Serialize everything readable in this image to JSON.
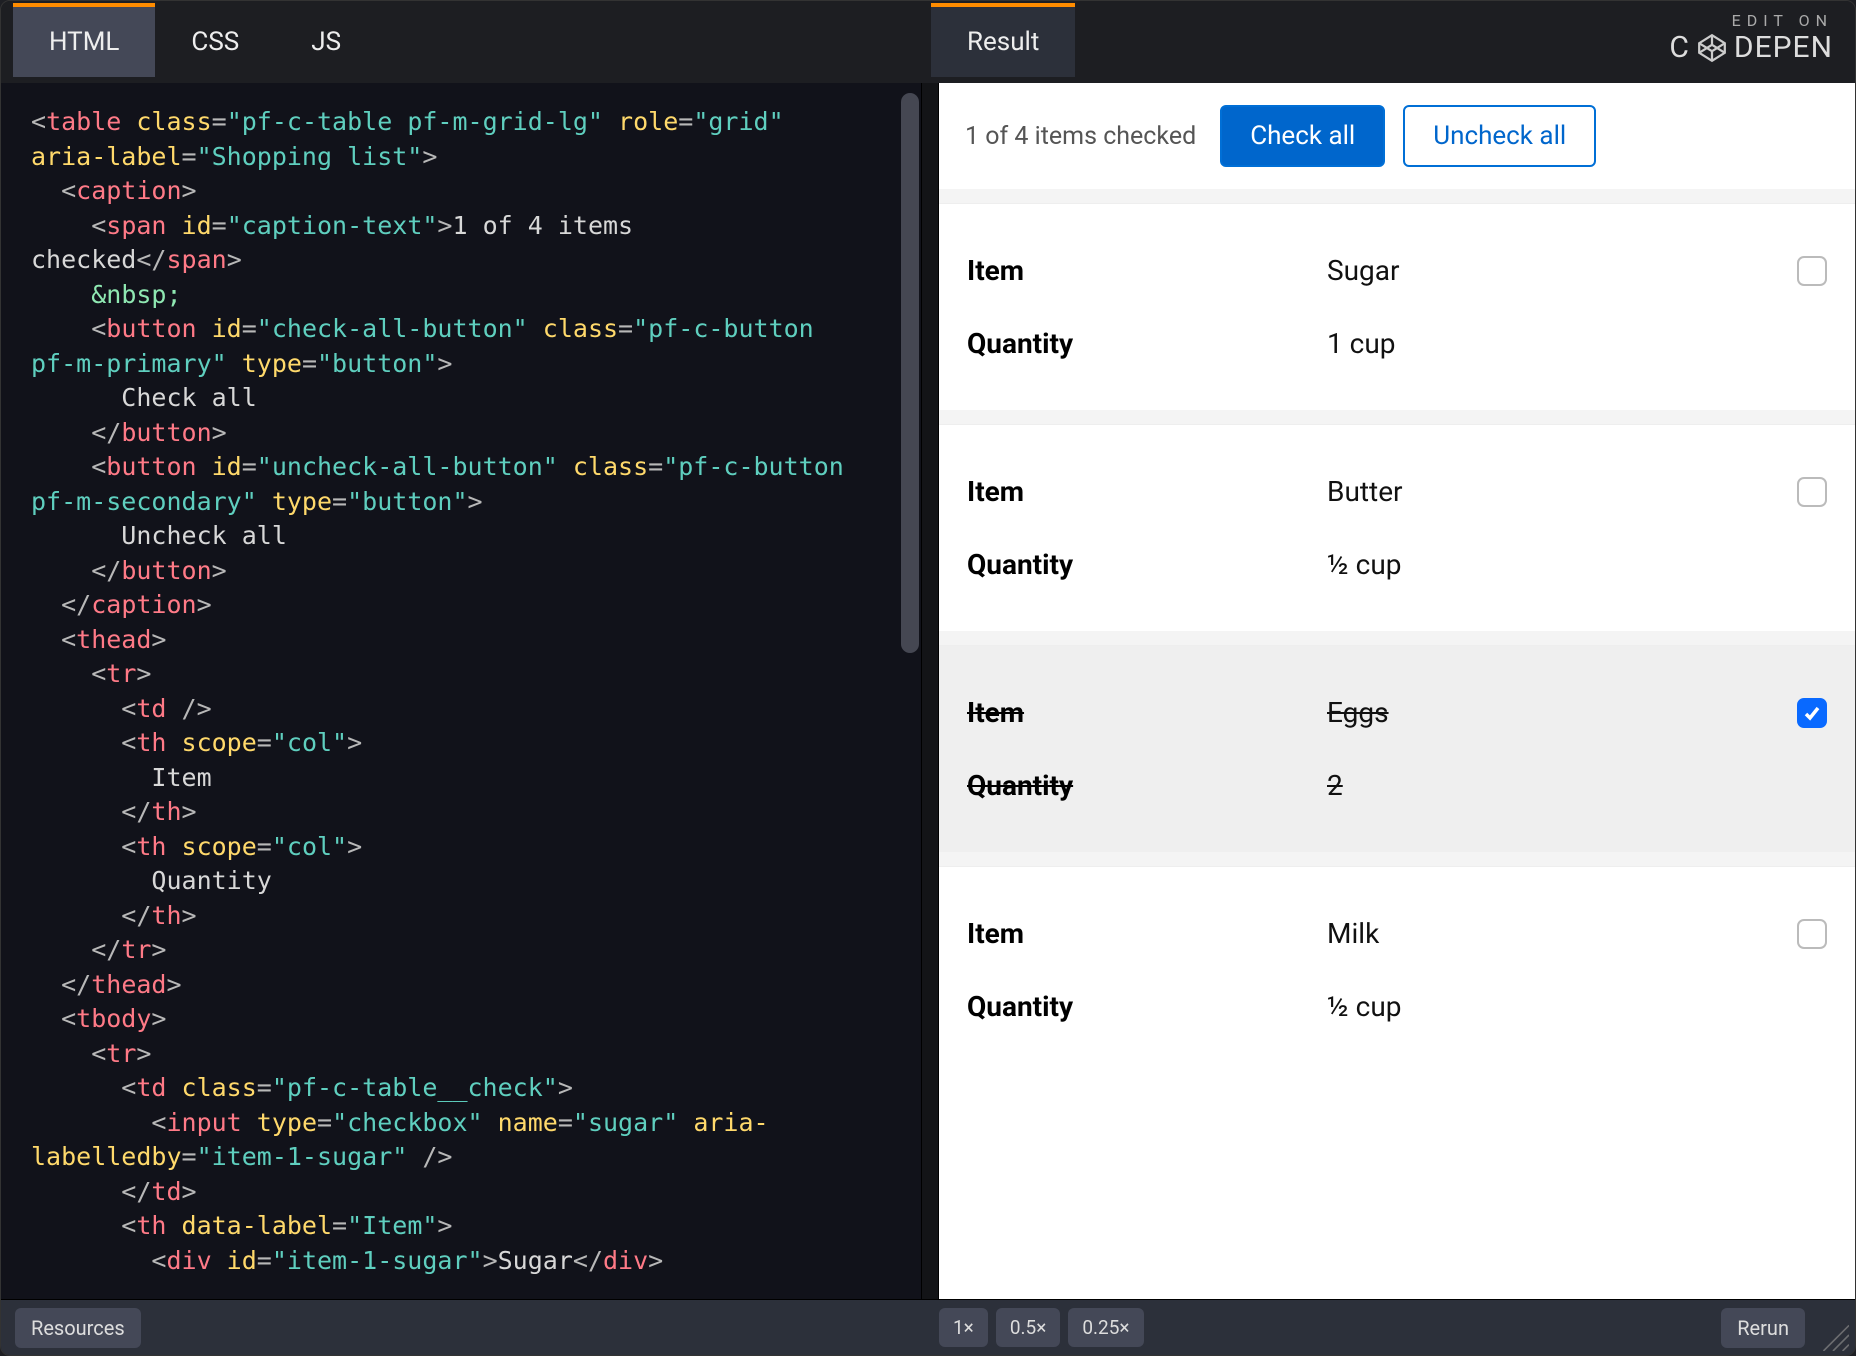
{
  "brand": {
    "edit_on": "EDIT ON",
    "name": "C   DEPEN"
  },
  "tabs": {
    "html": "HTML",
    "css": "CSS",
    "js": "JS",
    "result": "Result"
  },
  "code": {
    "l01a": "<",
    "l01b": "table",
    "l01c": " class",
    "l01d": "=",
    "l01e": "\"pf-c-table pf-m-grid-lg\"",
    "l01f": " role",
    "l01g": "=",
    "l01h": "\"grid\"",
    "l02a": "aria-label",
    "l02b": "=",
    "l02c": "\"Shopping list\"",
    "l02d": ">",
    "l03a": "  <",
    "l03b": "caption",
    "l03c": ">",
    "l04a": "    <",
    "l04b": "span",
    "l04c": " id",
    "l04d": "=",
    "l04e": "\"caption-text\"",
    "l04f": ">",
    "l04g": "1 of 4 items",
    "l05a": "checked",
    "l05b": "</",
    "l05c": "span",
    "l05d": ">",
    "l06a": "    ",
    "l06b": "&nbsp;",
    "l07a": "    <",
    "l07b": "button",
    "l07c": " id",
    "l07d": "=",
    "l07e": "\"check-all-button\"",
    "l07f": " class",
    "l07g": "=",
    "l07h": "\"pf-c-button",
    "l08a": "pf-m-primary\"",
    "l08b": " type",
    "l08c": "=",
    "l08d": "\"button\"",
    "l08e": ">",
    "l09a": "      Check all",
    "l10a": "    </",
    "l10b": "button",
    "l10c": ">",
    "l11a": "    <",
    "l11b": "button",
    "l11c": " id",
    "l11d": "=",
    "l11e": "\"uncheck-all-button\"",
    "l11f": " class",
    "l11g": "=",
    "l11h": "\"pf-c-button",
    "l12a": "pf-m-secondary\"",
    "l12b": " type",
    "l12c": "=",
    "l12d": "\"button\"",
    "l12e": ">",
    "l13a": "      Uncheck all",
    "l14a": "    </",
    "l14b": "button",
    "l14c": ">",
    "l15a": "  </",
    "l15b": "caption",
    "l15c": ">",
    "l16a": "  <",
    "l16b": "thead",
    "l16c": ">",
    "l17a": "    <",
    "l17b": "tr",
    "l17c": ">",
    "l18a": "      <",
    "l18b": "td",
    "l18c": " />",
    "l19a": "      <",
    "l19b": "th",
    "l19c": " scope",
    "l19d": "=",
    "l19e": "\"col\"",
    "l19f": ">",
    "l20a": "        Item",
    "l21a": "      </",
    "l21b": "th",
    "l21c": ">",
    "l22a": "      <",
    "l22b": "th",
    "l22c": " scope",
    "l22d": "=",
    "l22e": "\"col\"",
    "l22f": ">",
    "l23a": "        Quantity",
    "l24a": "      </",
    "l24b": "th",
    "l24c": ">",
    "l25a": "    </",
    "l25b": "tr",
    "l25c": ">",
    "l26a": "  </",
    "l26b": "thead",
    "l26c": ">",
    "l27a": "  <",
    "l27b": "tbody",
    "l27c": ">",
    "l28a": "    <",
    "l28b": "tr",
    "l28c": ">",
    "l29a": "      <",
    "l29b": "td",
    "l29c": " class",
    "l29d": "=",
    "l29e": "\"pf-c-table__check\"",
    "l29f": ">",
    "l30a": "        <",
    "l30b": "input",
    "l30c": " type",
    "l30d": "=",
    "l30e": "\"checkbox\"",
    "l30f": " name",
    "l30g": "=",
    "l30h": "\"sugar\"",
    "l30i": " aria-",
    "l31a": "labelledby",
    "l31b": "=",
    "l31c": "\"item-1-sugar\"",
    "l31d": " />",
    "l32a": "      </",
    "l32b": "td",
    "l32c": ">",
    "l33a": "      <",
    "l33b": "th",
    "l33c": " data-label",
    "l33d": "=",
    "l33e": "\"Item\"",
    "l33f": ">",
    "l34a": "        <",
    "l34b": "div",
    "l34c": " id",
    "l34d": "=",
    "l34e": "\"item-1-sugar\"",
    "l34f": ">",
    "l34g": "Sugar",
    "l34h": "</",
    "l34i": "div",
    "l34j": ">"
  },
  "result": {
    "caption": "1 of 4 items checked",
    "check_all": "Check all",
    "uncheck_all": "Uncheck all",
    "labels": {
      "item": "Item",
      "quantity": "Quantity"
    },
    "rows": [
      {
        "item": "Sugar",
        "qty": "1 cup",
        "checked": false
      },
      {
        "item": "Butter",
        "qty": "½ cup",
        "checked": false
      },
      {
        "item": "Eggs",
        "qty": "2",
        "checked": true
      },
      {
        "item": "Milk",
        "qty": "½ cup",
        "checked": false
      }
    ]
  },
  "footer": {
    "resources": "Resources",
    "zoom1": "1×",
    "zoom05": "0.5×",
    "zoom025": "0.25×",
    "rerun": "Rerun"
  }
}
